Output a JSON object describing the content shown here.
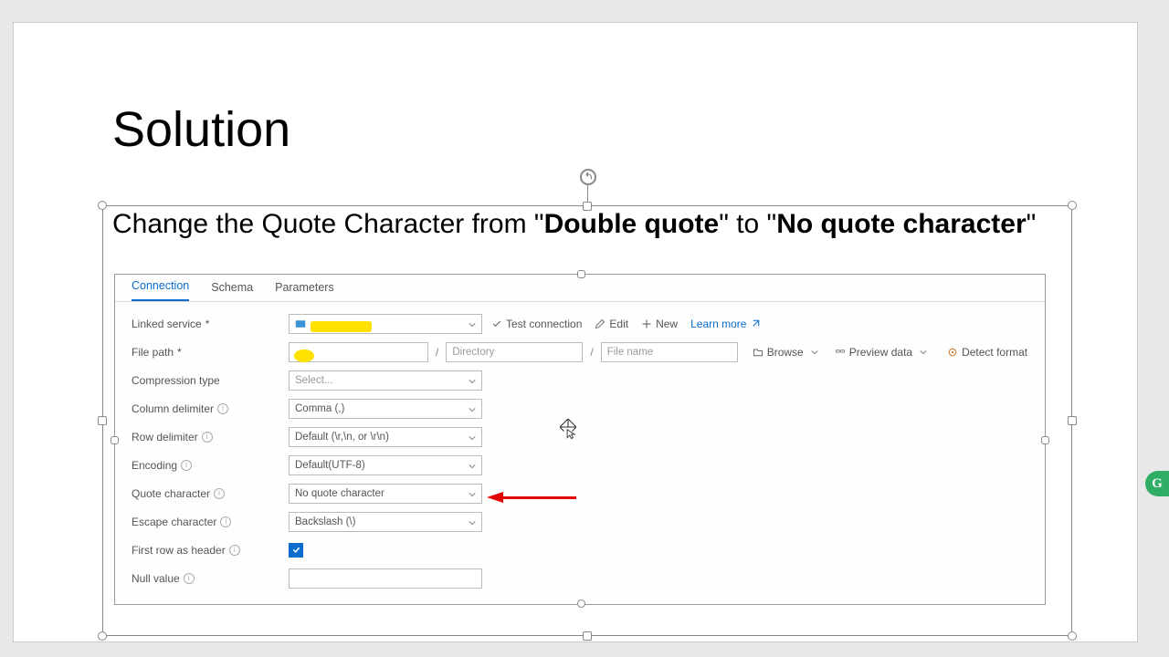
{
  "title": "Solution",
  "instruction": {
    "prefix": "Change the Quote Character from \"",
    "bold1": "Double quote",
    "mid": "\" to \"",
    "bold2": "No quote character",
    "suffix": "\""
  },
  "tabs": {
    "t0": "Connection",
    "t1": "Schema",
    "t2": "Parameters"
  },
  "labels": {
    "linked": "Linked service",
    "path": "File path",
    "compression": "Compression type",
    "coldelim": "Column delimiter",
    "rowdelim": "Row delimiter",
    "encoding": "Encoding",
    "quote": "Quote character",
    "escape": "Escape character",
    "firstrow": "First row as header",
    "nullval": "Null value"
  },
  "values": {
    "compression": "Select...",
    "coldelim": "Comma (,)",
    "rowdelim": "Default (\\r,\\n, or \\r\\n)",
    "encoding": "Default(UTF-8)",
    "quote": "No quote character",
    "escape": "Backslash (\\)"
  },
  "placeholders": {
    "directory": "Directory",
    "filename": "File name"
  },
  "actions": {
    "test": "Test connection",
    "edit": "Edit",
    "new": "New",
    "learn": "Learn more",
    "browse": "Browse",
    "preview": "Preview data",
    "detect": "Detect format"
  },
  "badge": "G"
}
